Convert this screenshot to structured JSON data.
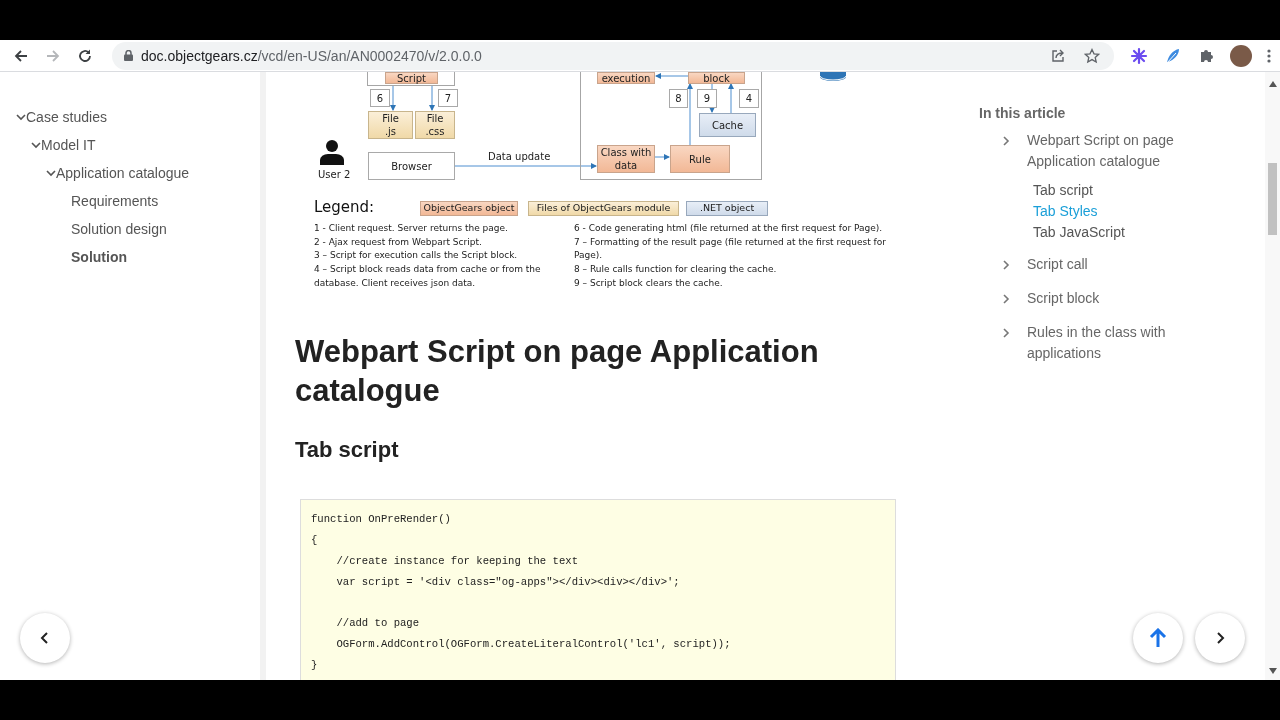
{
  "browser": {
    "back": {
      "disabled": false
    },
    "forward": {
      "disabled": true
    },
    "url_host": "doc.objectgears.cz",
    "url_path": "/vcd/en-US/an/AN0002470/v/2.0.0.0"
  },
  "sidebar": {
    "items": [
      {
        "label": "Case studies",
        "expanded": true,
        "selected": false,
        "children": [
          {
            "label": "Model IT",
            "expanded": true,
            "selected": false,
            "children": [
              {
                "label": "Application catalogue",
                "expanded": true,
                "selected": false,
                "children": [
                  {
                    "label": "Requirements",
                    "selected": false
                  },
                  {
                    "label": "Solution design",
                    "selected": false
                  },
                  {
                    "label": "Solution",
                    "selected": true
                  }
                ]
              }
            ]
          }
        ]
      }
    ]
  },
  "diagram": {
    "nodes": [
      {
        "label": "Script",
        "kind": "objectgears"
      },
      {
        "label": "execution",
        "kind": "objectgears"
      },
      {
        "label": "block",
        "kind": "objectgears"
      },
      {
        "label": "6",
        "kind": "step"
      },
      {
        "label": "7",
        "kind": "step"
      },
      {
        "label": "8",
        "kind": "step"
      },
      {
        "label": "9",
        "kind": "step"
      },
      {
        "label": "4",
        "kind": "step"
      },
      {
        "label": "File\n.js",
        "kind": "module"
      },
      {
        "label": "File\n.css",
        "kind": "module"
      },
      {
        "label": "Cache",
        "kind": "dotnet"
      },
      {
        "label": "Browser",
        "kind": "plain"
      },
      {
        "label": "Class with\ndata",
        "kind": "objectgears"
      },
      {
        "label": "Rule",
        "kind": "objectgears"
      }
    ],
    "edge_label": "Data update",
    "user_label": "User 2",
    "legend": {
      "title": "Legend:",
      "swatches": [
        {
          "label": "ObjectGears object",
          "kind": "objectgears"
        },
        {
          "label": "Files of ObjectGears module",
          "kind": "module"
        },
        {
          "label": ".NET object",
          "kind": "dotnet"
        }
      ],
      "notes_left": [
        "1 -  Client request. Server returns the page.",
        "2 - Ajax request from Webpart Script.",
        "3 – Script for execution calls the Script block.",
        "4 – Script block reads data from cache or from the database. Client receives json data."
      ],
      "notes_right": [
        "6 - Code generating html (file returned at the first request for Page).",
        "7 – Formatting of the result page (file returned at the first request for Page).",
        "8 – Rule calls function for clearing the cache.",
        "9 – Script block clears the cache."
      ]
    }
  },
  "article": {
    "title": "Webpart Script on page Application catalogue",
    "subtitle": "Tab script",
    "code_blocks": [
      [
        "function OnPreRender()",
        "{",
        "    //create instance for keeping the text",
        "    var script = '<div class=\"og-apps\"></div><div></div>';"
      ],
      [
        "    //add to page",
        "    OGForm.AddControl(OGForm.CreateLiteralControl('lc1', script));",
        "}"
      ]
    ]
  },
  "toc": {
    "title": "In this article",
    "items": [
      {
        "label": "Webpart Script on page Application catalogue",
        "selected": false,
        "children": [
          {
            "label": "Tab script",
            "selected": false
          },
          {
            "label": "Tab Styles",
            "selected": true
          },
          {
            "label": "Tab JavaScript",
            "selected": false
          }
        ]
      },
      {
        "label": "Script call",
        "selected": false
      },
      {
        "label": "Script block",
        "selected": false
      },
      {
        "label": "Rules in the class with applications",
        "selected": false
      }
    ]
  }
}
